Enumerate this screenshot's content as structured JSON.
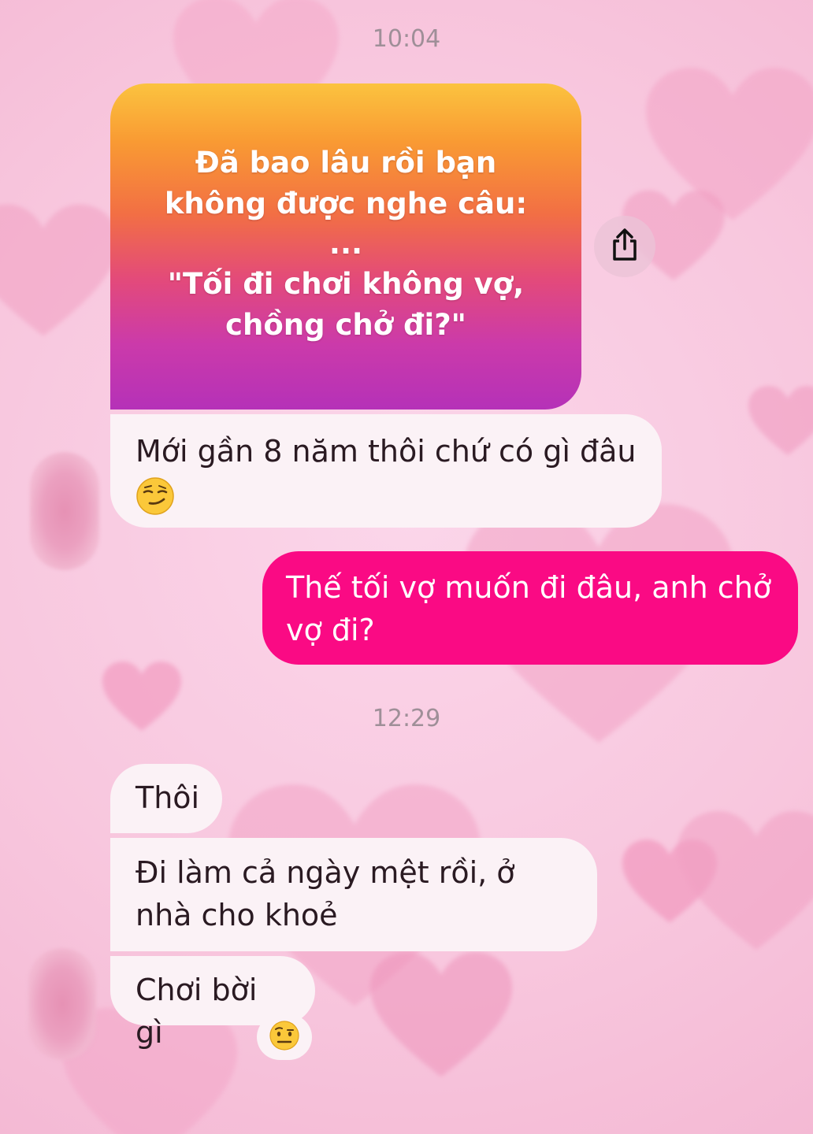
{
  "conversation": {
    "timestamps": [
      "10:04",
      "12:29"
    ],
    "shared_post": {
      "lines": [
        "Đã bao lâu rồi bạn",
        "không được nghe câu:",
        "...",
        "\"Tối đi chơi không vợ,",
        "chồng chở đi?\""
      ],
      "gradient_colors": [
        "#fbc33f",
        "#f26f44",
        "#b531b8"
      ]
    },
    "share_button": {
      "icon": "share-icon"
    },
    "messages": [
      {
        "from": "them",
        "text": "Mới gần 8 năm thôi chứ có gì đâu",
        "emoji": "smirking-face"
      },
      {
        "from": "me",
        "text": "Thế tối vợ muốn đi đâu, anh chở vợ đi?"
      },
      {
        "from": "them",
        "text": "Thôi"
      },
      {
        "from": "them",
        "text": "Đi làm cả ngày mệt rồi, ở nhà cho khoẻ"
      },
      {
        "from": "them",
        "text": "Chơi bời gì",
        "reaction": "face-with-raised-eyebrow"
      }
    ]
  },
  "colors": {
    "background": "#f8c7de",
    "incoming_bubble": "#fbf2f6",
    "outgoing_bubble": "#fa0a84",
    "timestamp_text": "#9f8f98"
  }
}
